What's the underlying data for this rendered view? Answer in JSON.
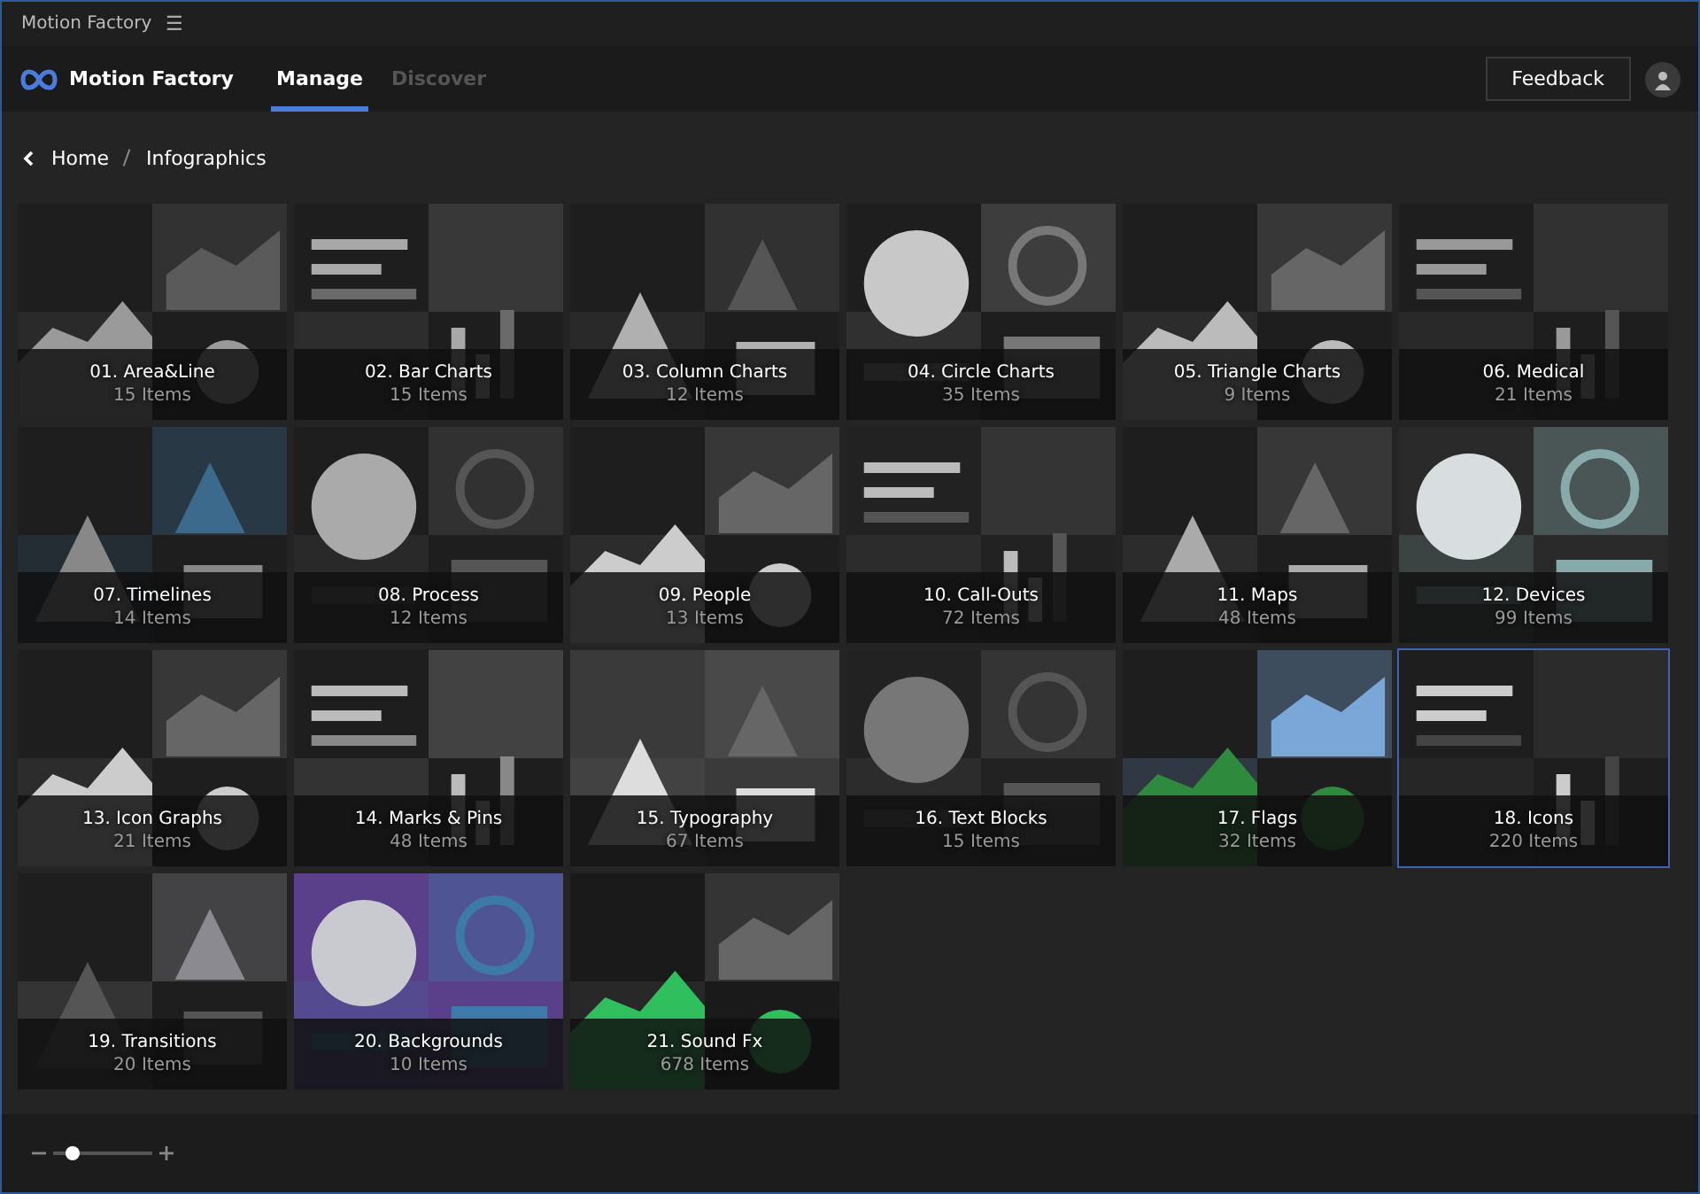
{
  "window": {
    "title": "Motion Factory",
    "menu_glyph": "☰"
  },
  "header": {
    "brand": "Motion Factory",
    "tabs": [
      {
        "label": "Manage",
        "selected": true
      },
      {
        "label": "Discover",
        "selected": false
      }
    ],
    "feedback": "Feedback"
  },
  "breadcrumb": [
    "Home",
    "Infographics"
  ],
  "tiles": [
    {
      "title": "01. Area&Line",
      "count": "15 Items",
      "selected": false
    },
    {
      "title": "02. Bar Charts",
      "count": "15 Items",
      "selected": false
    },
    {
      "title": "03. Column Charts",
      "count": "12 Items",
      "selected": false
    },
    {
      "title": "04. Circle Charts",
      "count": "35 Items",
      "selected": false
    },
    {
      "title": "05. Triangle Charts",
      "count": "9 Items",
      "selected": false
    },
    {
      "title": "06. Medical",
      "count": "21 Items",
      "selected": false
    },
    {
      "title": "07. Timelines",
      "count": "14 Items",
      "selected": false
    },
    {
      "title": "08. Process",
      "count": "12 Items",
      "selected": false
    },
    {
      "title": "09. People",
      "count": "13 Items",
      "selected": false
    },
    {
      "title": "10. Call-Outs",
      "count": "72 Items",
      "selected": false
    },
    {
      "title": "11. Maps",
      "count": "48 Items",
      "selected": false
    },
    {
      "title": "12. Devices",
      "count": "99 Items",
      "selected": false
    },
    {
      "title": "13. Icon Graphs",
      "count": "21 Items",
      "selected": false
    },
    {
      "title": "14. Marks & Pins",
      "count": "48 Items",
      "selected": false
    },
    {
      "title": "15. Typography",
      "count": "67 Items",
      "selected": false
    },
    {
      "title": "16. Text Blocks",
      "count": "15 Items",
      "selected": false
    },
    {
      "title": "17. Flags",
      "count": "32 Items",
      "selected": false
    },
    {
      "title": "18. Icons",
      "count": "220 Items",
      "selected": true
    },
    {
      "title": "19. Transitions",
      "count": "20 Items",
      "selected": false
    },
    {
      "title": "20. Backgrounds",
      "count": "10 Items",
      "selected": false
    },
    {
      "title": "21. Sound Fx",
      "count": "678 Items",
      "selected": false
    }
  ],
  "zoom": {
    "level": 0.2
  }
}
